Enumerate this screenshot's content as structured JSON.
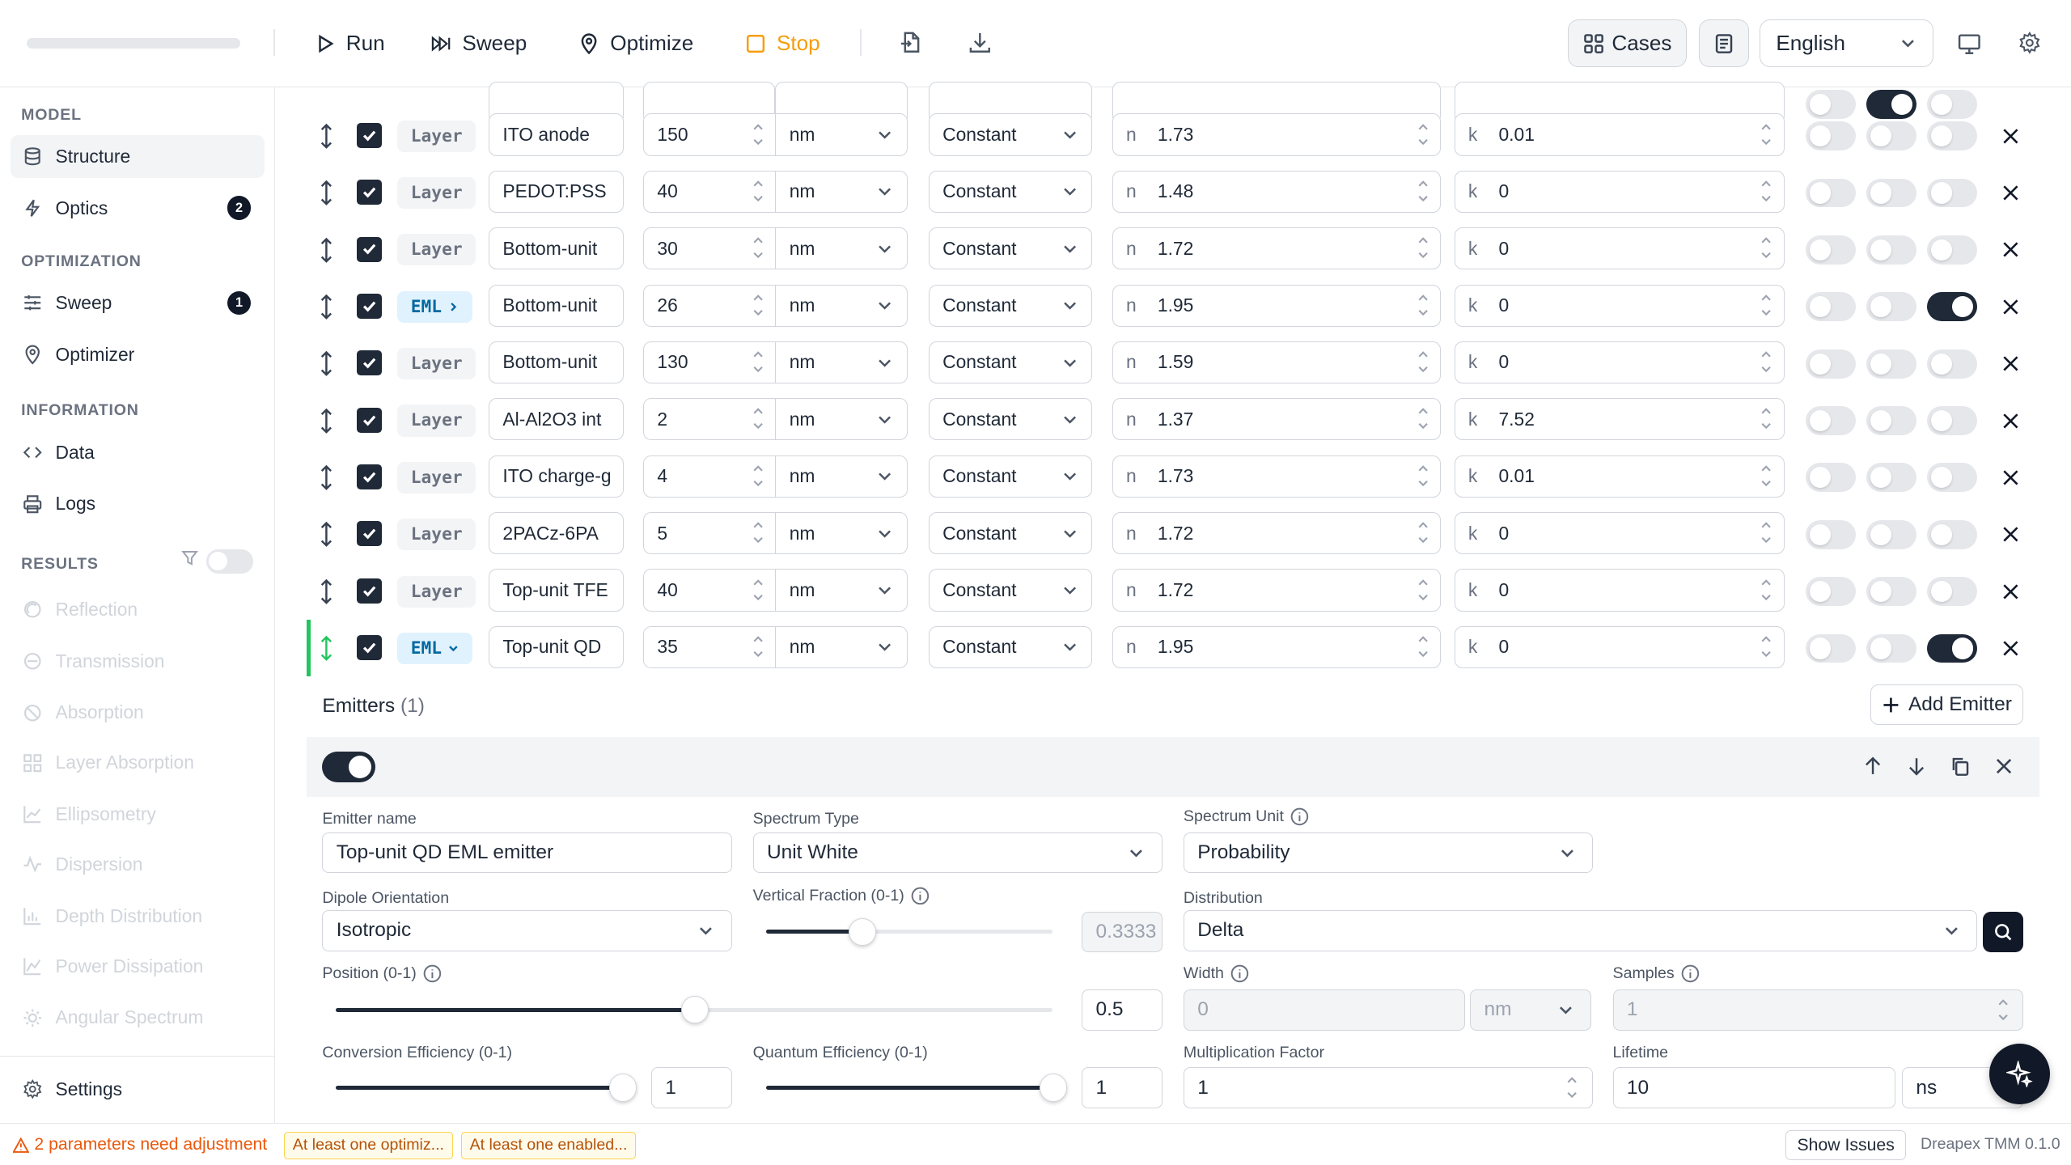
{
  "toolbar": {
    "run": "Run",
    "sweep": "Sweep",
    "optimize": "Optimize",
    "stop": "Stop",
    "cases": "Cases",
    "language": "English"
  },
  "sidebar": {
    "model_title": "MODEL",
    "structure": "Structure",
    "optics": "Optics",
    "optics_badge": "2",
    "optimization_title": "OPTIMIZATION",
    "sweep": "Sweep",
    "sweep_badge": "1",
    "optimizer": "Optimizer",
    "information_title": "INFORMATION",
    "data": "Data",
    "logs": "Logs",
    "results_title": "RESULTS",
    "results": [
      "Reflection",
      "Transmission",
      "Absorption",
      "Layer Absorption",
      "Ellipsometry",
      "Dispersion",
      "Depth Distribution",
      "Power Dissipation",
      "Angular Spectrum"
    ],
    "settings": "Settings"
  },
  "layers": [
    {
      "type": "Layer",
      "name": "ITO anode",
      "thickness": "150",
      "unit": "nm",
      "model": "Constant",
      "n_label": "n",
      "n": "1.73",
      "k_label": "k",
      "k": "0.01",
      "t1": false,
      "t2": false,
      "t3": false
    },
    {
      "type": "Layer",
      "name": "PEDOT:PSS",
      "thickness": "40",
      "unit": "nm",
      "model": "Constant",
      "n_label": "n",
      "n": "1.48",
      "k_label": "k",
      "k": "0",
      "t1": false,
      "t2": false,
      "t3": false
    },
    {
      "type": "Layer",
      "name": "Bottom-unit",
      "thickness": "30",
      "unit": "nm",
      "model": "Constant",
      "n_label": "n",
      "n": "1.72",
      "k_label": "k",
      "k": "0",
      "t1": false,
      "t2": false,
      "t3": false
    },
    {
      "type": "EML",
      "name": "Bottom-unit",
      "thickness": "26",
      "unit": "nm",
      "model": "Constant",
      "n_label": "n",
      "n": "1.95",
      "k_label": "k",
      "k": "0",
      "t1": false,
      "t2": false,
      "t3": true
    },
    {
      "type": "Layer",
      "name": "Bottom-unit",
      "thickness": "130",
      "unit": "nm",
      "model": "Constant",
      "n_label": "n",
      "n": "1.59",
      "k_label": "k",
      "k": "0",
      "t1": false,
      "t2": false,
      "t3": false
    },
    {
      "type": "Layer",
      "name": "Al-Al2O3 int",
      "thickness": "2",
      "unit": "nm",
      "model": "Constant",
      "n_label": "n",
      "n": "1.37",
      "k_label": "k",
      "k": "7.52",
      "t1": false,
      "t2": false,
      "t3": false
    },
    {
      "type": "Layer",
      "name": "ITO charge-g",
      "thickness": "4",
      "unit": "nm",
      "model": "Constant",
      "n_label": "n",
      "n": "1.73",
      "k_label": "k",
      "k": "0.01",
      "t1": false,
      "t2": false,
      "t3": false
    },
    {
      "type": "Layer",
      "name": "2PACz-6PA",
      "thickness": "5",
      "unit": "nm",
      "model": "Constant",
      "n_label": "n",
      "n": "1.72",
      "k_label": "k",
      "k": "0",
      "t1": false,
      "t2": false,
      "t3": false
    },
    {
      "type": "Layer",
      "name": "Top-unit TFE",
      "thickness": "40",
      "unit": "nm",
      "model": "Constant",
      "n_label": "n",
      "n": "1.72",
      "k_label": "k",
      "k": "0",
      "t1": false,
      "t2": false,
      "t3": false
    },
    {
      "type": "EML",
      "name": "Top-unit QD",
      "thickness": "35",
      "unit": "nm",
      "model": "Constant",
      "n_label": "n",
      "n": "1.95",
      "k_label": "k",
      "k": "0",
      "t1": false,
      "t2": false,
      "t3": true
    }
  ],
  "emitters": {
    "title": "Emitters",
    "count": "(1)",
    "add_label": "Add Emitter",
    "emitter_name_label": "Emitter name",
    "emitter_name": "Top-unit QD EML emitter",
    "spectrum_type_label": "Spectrum Type",
    "spectrum_type": "Unit White",
    "spectrum_unit_label": "Spectrum Unit",
    "spectrum_unit": "Probability",
    "dipole_label": "Dipole Orientation",
    "dipole": "Isotropic",
    "vertical_label": "Vertical Fraction (0-1)",
    "vertical_value": "0.3333",
    "vertical_fraction": 0.333,
    "distribution_label": "Distribution",
    "distribution": "Delta",
    "position_label": "Position (0-1)",
    "position_value": "0.5",
    "position_fraction": 0.5,
    "width_label": "Width",
    "width": "0",
    "width_unit": "nm",
    "samples_label": "Samples",
    "samples": "1",
    "conversion_label": "Conversion Efficiency (0-1)",
    "conversion_value": "1",
    "conversion_fraction": 1,
    "quantum_label": "Quantum Efficiency (0-1)",
    "quantum_value": "1",
    "quantum_fraction": 1,
    "multiplication_label": "Multiplication Factor",
    "multiplication": "1",
    "lifetime_label": "Lifetime",
    "lifetime": "10",
    "lifetime_unit": "ns"
  },
  "status": {
    "warning": "2 parameters need adjustment",
    "chip1": "At least one optimiz...",
    "chip2": "At least one enabled...",
    "show_issues": "Show Issues",
    "version": "Dreapex TMM 0.1.0"
  },
  "colors": {
    "accent_active": "#22c55e",
    "warning": "#ea580c",
    "stop": "#f59e0b",
    "eml_tag": "#0369a1"
  }
}
